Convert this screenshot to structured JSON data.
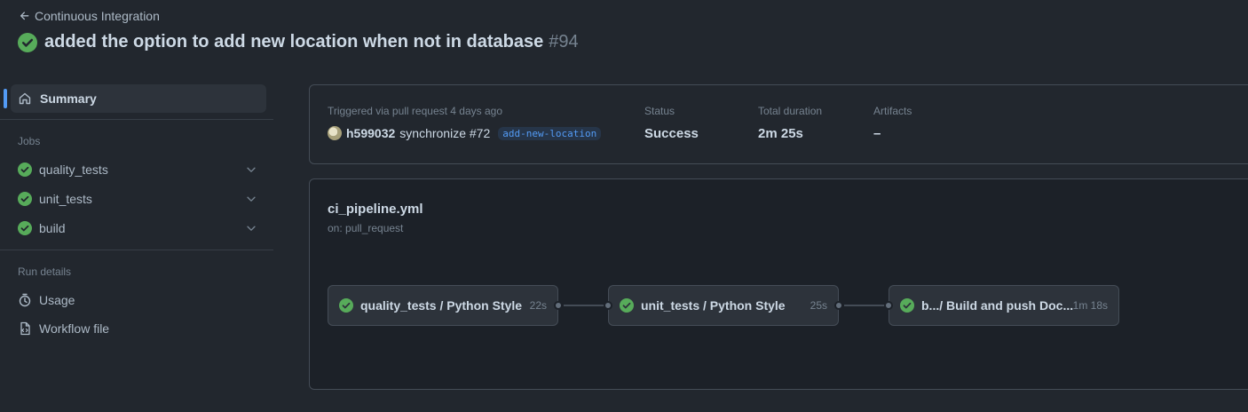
{
  "header": {
    "back_label": "Continuous Integration",
    "title": "added the option to add new location when not in database",
    "run_number": "#94"
  },
  "sidebar": {
    "summary_label": "Summary",
    "jobs_heading": "Jobs",
    "jobs": [
      {
        "label": "quality_tests",
        "status": "success"
      },
      {
        "label": "unit_tests",
        "status": "success"
      },
      {
        "label": "build",
        "status": "success"
      }
    ],
    "run_details_heading": "Run details",
    "details": [
      {
        "label": "Usage",
        "icon": "stopwatch-icon"
      },
      {
        "label": "Workflow file",
        "icon": "file-code-icon"
      }
    ]
  },
  "summary": {
    "trigger_label": "Triggered via pull request 4 days ago",
    "actor": "h599032",
    "event_text": "synchronize #72",
    "branch": "add-new-location",
    "status_label": "Status",
    "status_value": "Success",
    "duration_label": "Total duration",
    "duration_value": "2m 25s",
    "artifacts_label": "Artifacts",
    "artifacts_value": "–"
  },
  "workflow": {
    "file_name": "ci_pipeline.yml",
    "trigger": "on: pull_request",
    "nodes": [
      {
        "label": "quality_tests / Python Style",
        "duration": "22s"
      },
      {
        "label": "unit_tests / Python Style",
        "duration": "25s"
      },
      {
        "label": "b.../ Build and push Doc...",
        "duration": "1m 18s"
      }
    ]
  },
  "colors": {
    "success": "#57ab5a",
    "accent": "#539bf5",
    "background": "#22272e"
  }
}
